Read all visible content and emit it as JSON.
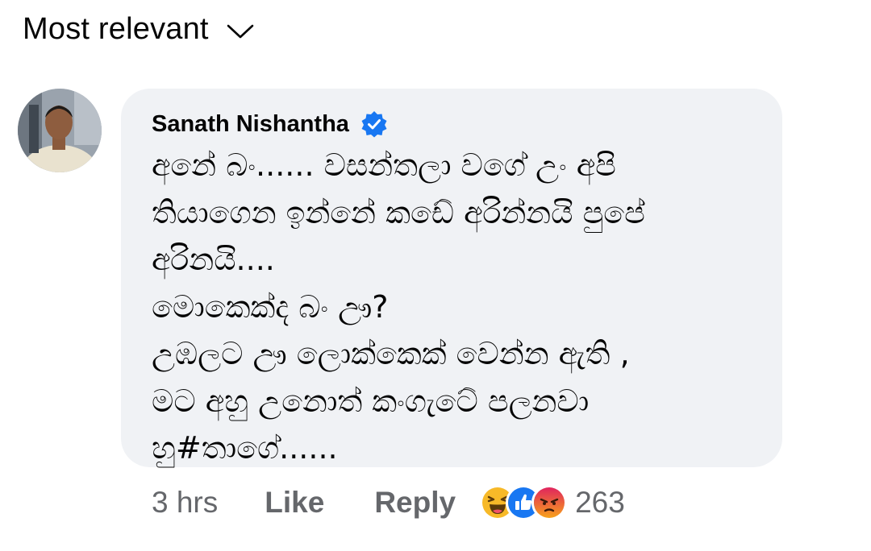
{
  "sort": {
    "label": "Most relevant"
  },
  "comment": {
    "author": "Sanath Nishantha",
    "verified": true,
    "lines": [
      "අනේ බං......  වසන්තලා වගේ උං අපි",
      "තියාගෙන ඉන්නේ කඩේ අරින්නයි පුපේ",
      "අරිනයි....",
      "මොකෙක්ද බං ඌ?",
      "උඹලට ඌ ලොක්කෙක් වෙන්න ඇති ,",
      "මට අහු උනොත් කංගැටේ පලනවා",
      "හු#තාගේ......"
    ],
    "time": "3 hrs",
    "like_label": "Like",
    "reply_label": "Reply",
    "reaction_count": "263",
    "reactions": [
      "haha",
      "like",
      "angry"
    ]
  },
  "colors": {
    "bubble_bg": "#f0f2f5",
    "meta_text": "#65676b",
    "verified_blue": "#1877f2",
    "like_blue": "#1877f2",
    "haha_yellow": "#f7b928",
    "angry_orange": "#e9710f"
  }
}
